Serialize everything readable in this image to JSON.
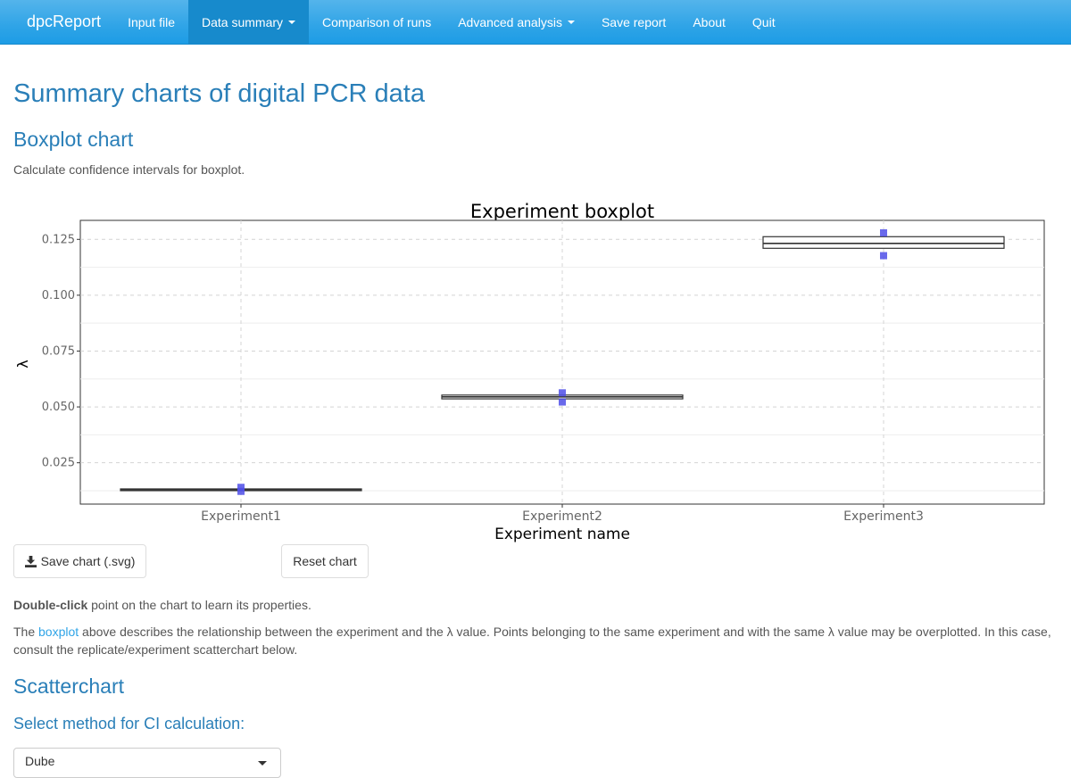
{
  "navbar": {
    "brand": "dpcReport",
    "items": [
      {
        "label": "Input file",
        "active": false,
        "dropdown": false
      },
      {
        "label": "Data summary",
        "active": true,
        "dropdown": true
      },
      {
        "label": "Comparison of runs",
        "active": false,
        "dropdown": false
      },
      {
        "label": "Advanced analysis",
        "active": false,
        "dropdown": true
      },
      {
        "label": "Save report",
        "active": false,
        "dropdown": false
      },
      {
        "label": "About",
        "active": false,
        "dropdown": false
      },
      {
        "label": "Quit",
        "active": false,
        "dropdown": false
      }
    ]
  },
  "page": {
    "title": "Summary charts of digital PCR data",
    "boxplot_heading": "Boxplot chart",
    "boxplot_intro": "Calculate confidence intervals for boxplot.",
    "save_button": "Save chart (.svg)",
    "reset_button": "Reset chart",
    "hint_bold": "Double-click",
    "hint_rest": " point on the chart to learn its properties.",
    "desc_pre": "The ",
    "desc_link": "boxplot",
    "desc_post": " above describes the relationship between the experiment and the λ value. Points belonging to the same experiment and with the same λ value may be overplotted. In this case, consult the replicate/experiment scatterchart below.",
    "scatter_heading": "Scatterchart",
    "ci_label": "Select method for CI calculation:",
    "ci_selected": "Dube"
  },
  "colors": {
    "navbar": "#2fa4e7",
    "heading": "#2a7fb8",
    "point": "#4f4fe8"
  },
  "chart_data": {
    "type": "box",
    "title": "Experiment boxplot",
    "xlabel": "Experiment name",
    "ylabel": "λ",
    "categories": [
      "Experiment1",
      "Experiment2",
      "Experiment3"
    ],
    "ylim": [
      0.0065,
      0.1335
    ],
    "yticks": [
      0.025,
      0.05,
      0.075,
      0.1,
      0.125
    ],
    "ytick_labels": [
      "0.025",
      "0.050",
      "0.075",
      "0.100",
      "0.125"
    ],
    "grid": true,
    "boxes": [
      {
        "q1": 0.0128,
        "median": 0.013,
        "q3": 0.0133
      },
      {
        "q1": 0.0536,
        "median": 0.0545,
        "q3": 0.0553
      },
      {
        "q1": 0.121,
        "median": 0.1232,
        "q3": 0.1262
      }
    ],
    "points": [
      {
        "category": "Experiment1",
        "y": 0.0122
      },
      {
        "category": "Experiment1",
        "y": 0.014
      },
      {
        "category": "Experiment2",
        "y": 0.0522
      },
      {
        "category": "Experiment2",
        "y": 0.0563
      },
      {
        "category": "Experiment3",
        "y": 0.1177
      },
      {
        "category": "Experiment3",
        "y": 0.1279
      }
    ]
  }
}
